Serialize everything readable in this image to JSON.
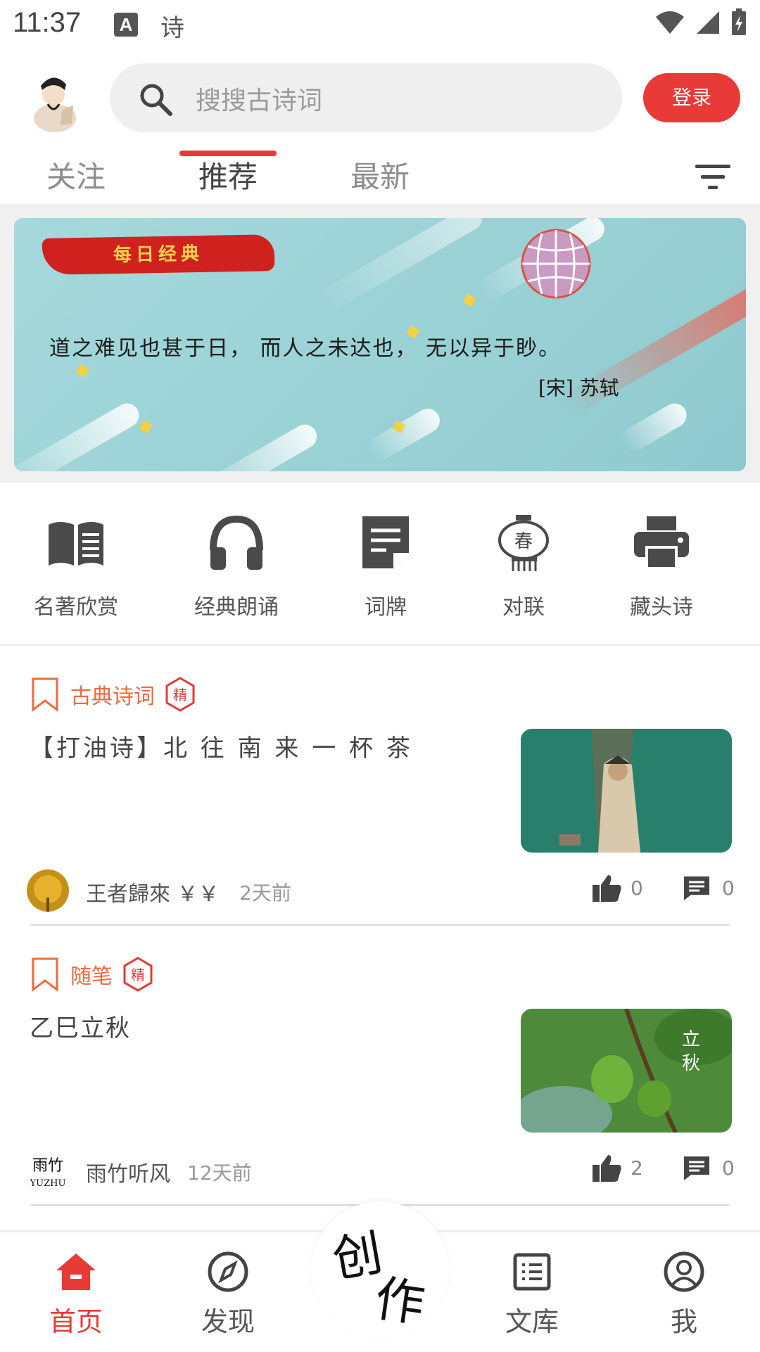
{
  "status": {
    "time": "11:37",
    "notif_letter": "A",
    "notif_app": "诗"
  },
  "header": {
    "search_placeholder": "搜搜古诗词",
    "login_label": "登录"
  },
  "tabs": [
    {
      "label": "关注"
    },
    {
      "label": "推荐"
    },
    {
      "label": "最新"
    }
  ],
  "banner": {
    "tag": "每日经典",
    "quote": "道之难见也甚于日， 而人之未达也， 无以异于眇。",
    "author": "[宋] 苏轼"
  },
  "quick_links": [
    {
      "label": "名著欣赏",
      "icon": "book-icon"
    },
    {
      "label": "经典朗诵",
      "icon": "headphones-icon"
    },
    {
      "label": "词牌",
      "icon": "note-icon"
    },
    {
      "label": "对联",
      "icon": "lantern-icon",
      "glyph": "春"
    },
    {
      "label": "藏头诗",
      "icon": "printer-icon"
    }
  ],
  "posts": [
    {
      "category": "古典诗词",
      "badge": "精",
      "title": "【打油诗】北 往 南 来 一  杯 茶",
      "author": "王者歸來 ￥￥",
      "time": "2天前",
      "likes": "0",
      "comments": "0"
    },
    {
      "category": "随笔",
      "badge": "精",
      "title": "乙巳立秋",
      "thumb_text": [
        "立",
        "秋"
      ],
      "author_avatar_text": [
        "雨竹",
        "YUZHU"
      ],
      "author": "雨竹听风",
      "time": "12天前",
      "likes": "2",
      "comments": "0"
    }
  ],
  "nav": {
    "home": "首页",
    "discover": "发现",
    "create_1": "创",
    "create_2": "作",
    "library": "文库",
    "me": "我"
  },
  "colors": {
    "accent": "#e83a37",
    "category": "#ee6a42"
  }
}
